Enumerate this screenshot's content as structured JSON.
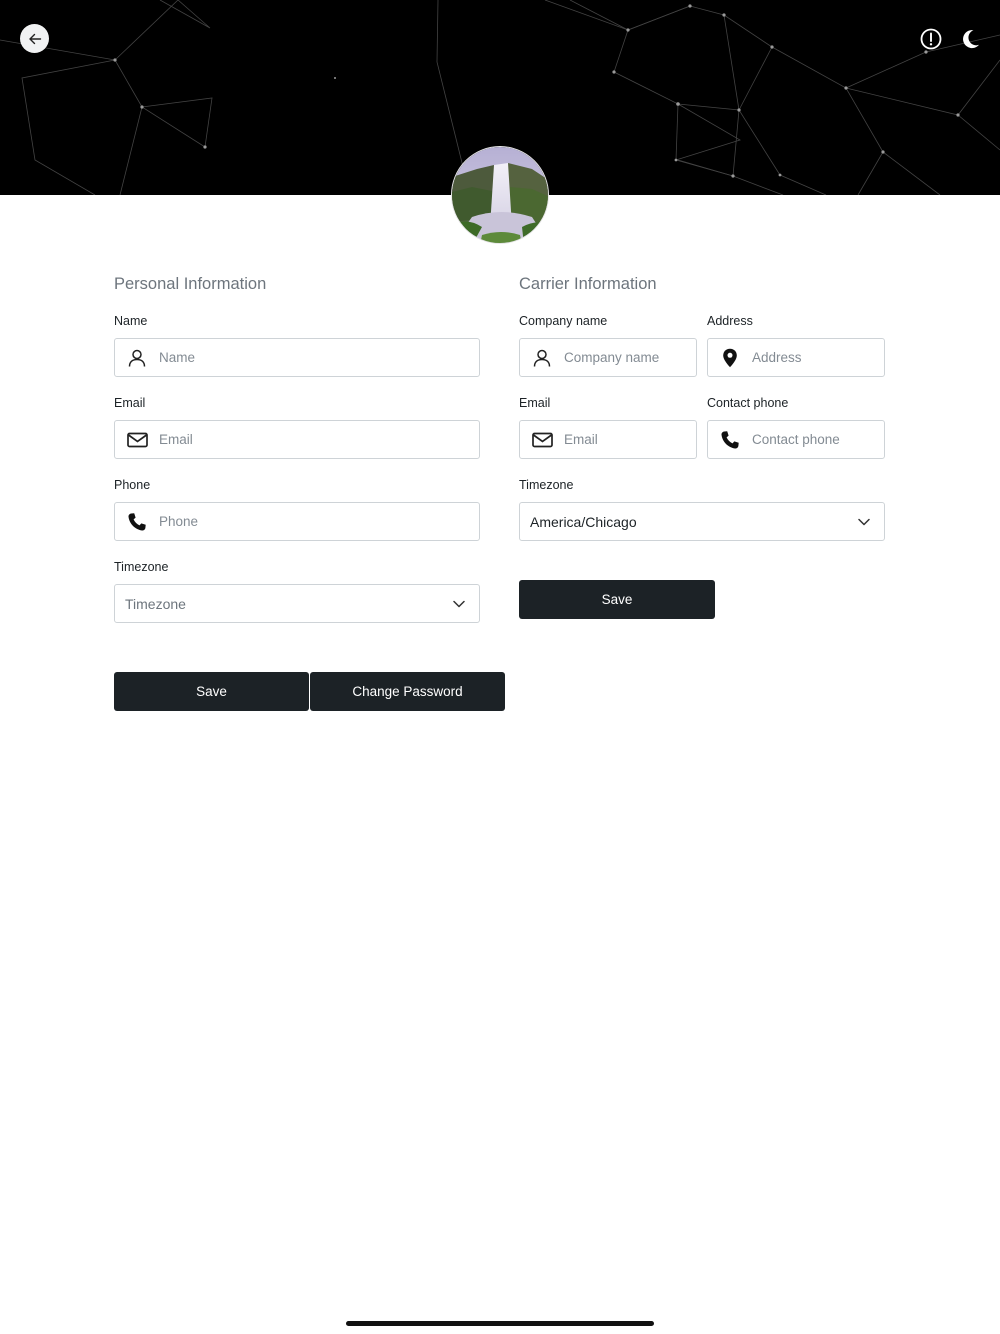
{
  "header": {
    "back_icon": "arrow-left-icon",
    "info_icon": "exclamation-circle-icon",
    "theme_icon": "moon-icon"
  },
  "profile": {
    "avatar": "waterfall-photo"
  },
  "personal": {
    "title": "Personal Information",
    "name": {
      "label": "Name",
      "placeholder": "Name",
      "icon": "user-icon"
    },
    "email": {
      "label": "Email",
      "placeholder": "Email",
      "icon": "envelope-icon"
    },
    "phone": {
      "label": "Phone",
      "placeholder": "Phone",
      "icon": "phone-icon"
    },
    "timezone": {
      "label": "Timezone",
      "placeholder": "Timezone",
      "icon": "chevron-down-icon"
    },
    "save_label": "Save",
    "change_password_label": "Change Password"
  },
  "carrier": {
    "title": "Carrier Information",
    "company_name": {
      "label": "Company name",
      "placeholder": "Company name",
      "icon": "user-icon"
    },
    "address": {
      "label": "Address",
      "placeholder": "Address",
      "icon": "map-pin-icon"
    },
    "email": {
      "label": "Email",
      "placeholder": "Email",
      "icon": "envelope-icon"
    },
    "contact_phone": {
      "label": "Contact phone",
      "placeholder": "Contact phone",
      "icon": "phone-icon"
    },
    "timezone": {
      "label": "Timezone",
      "value": "America/Chicago",
      "icon": "chevron-down-icon"
    },
    "save_label": "Save"
  },
  "colors": {
    "header_bg": "#000000",
    "button_bg": "#1c2226",
    "button_text": "#ffffff",
    "section_title": "#6d757d",
    "input_border": "#ced3d7"
  }
}
